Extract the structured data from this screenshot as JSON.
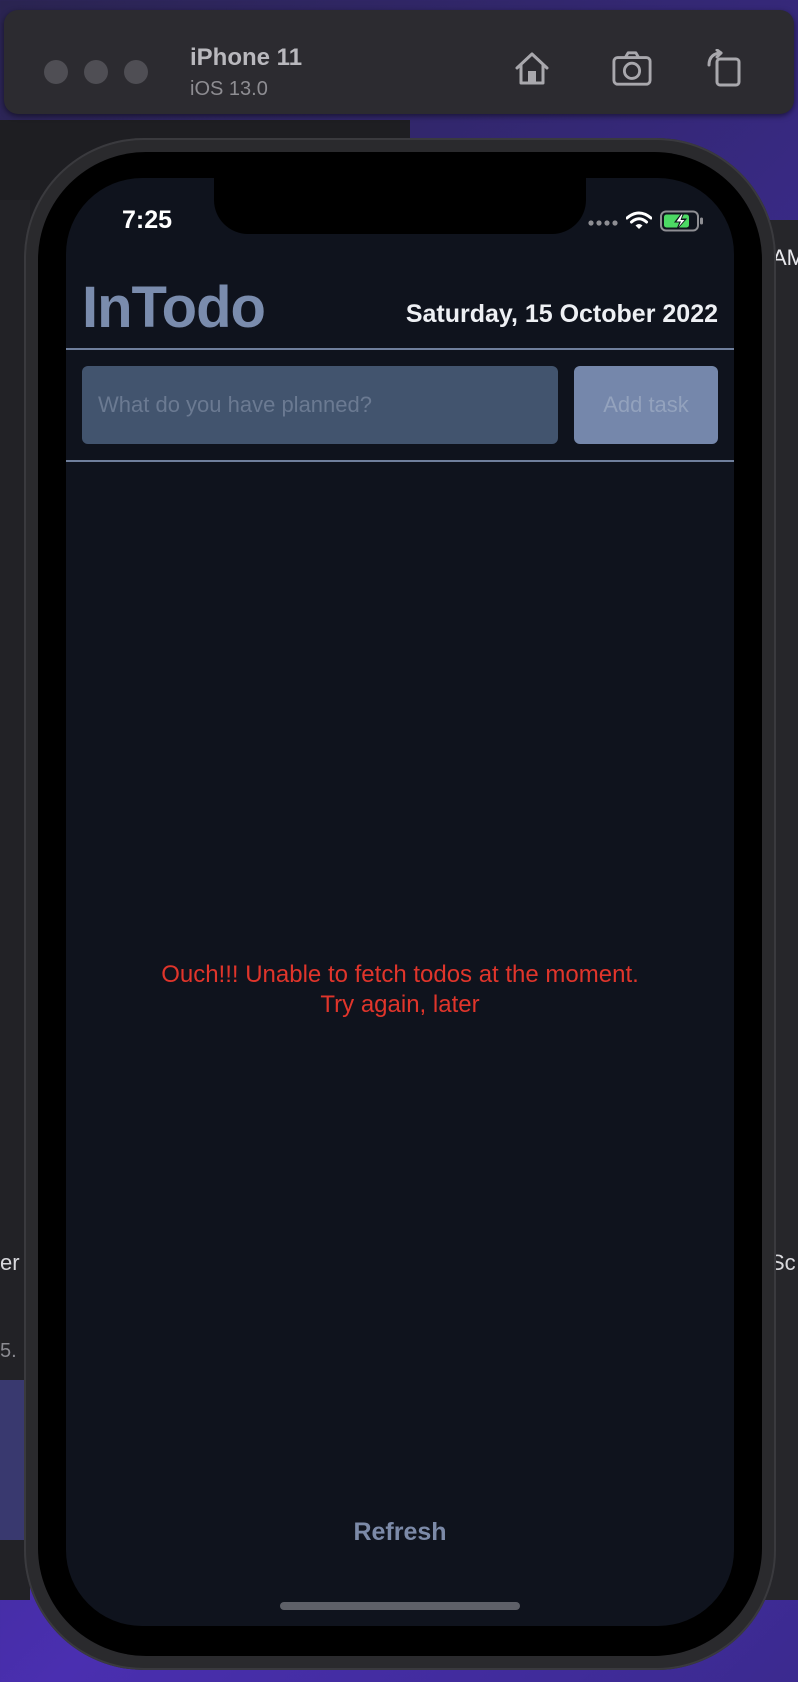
{
  "simulator": {
    "device_name": "iPhone 11",
    "os_version": "iOS 13.0",
    "tools": [
      "home-icon",
      "screenshot-icon",
      "rotate-icon"
    ]
  },
  "background": {
    "right_text_top": "AM",
    "left_text": "er",
    "right_text": "Sc",
    "left_bottom_text": "5."
  },
  "status_bar": {
    "time": "7:25",
    "icons": [
      "signal-icon",
      "wifi-icon",
      "battery-charging-icon"
    ]
  },
  "app": {
    "title": "InTodo",
    "date": "Saturday, 15 October 2022",
    "input": {
      "placeholder": "What do you have planned?",
      "value": ""
    },
    "add_button_label": "Add task",
    "error_line1": "Ouch!!! Unable to fetch todos at the moment.",
    "error_line2": "Try again, later",
    "refresh_label": "Refresh"
  },
  "colors": {
    "screen_bg": "#0f131d",
    "title": "#7a8cad",
    "error": "#e0352b",
    "input_bg": "#42546e",
    "button_bg": "#7587ab",
    "battery_charging": "#4cd964"
  }
}
